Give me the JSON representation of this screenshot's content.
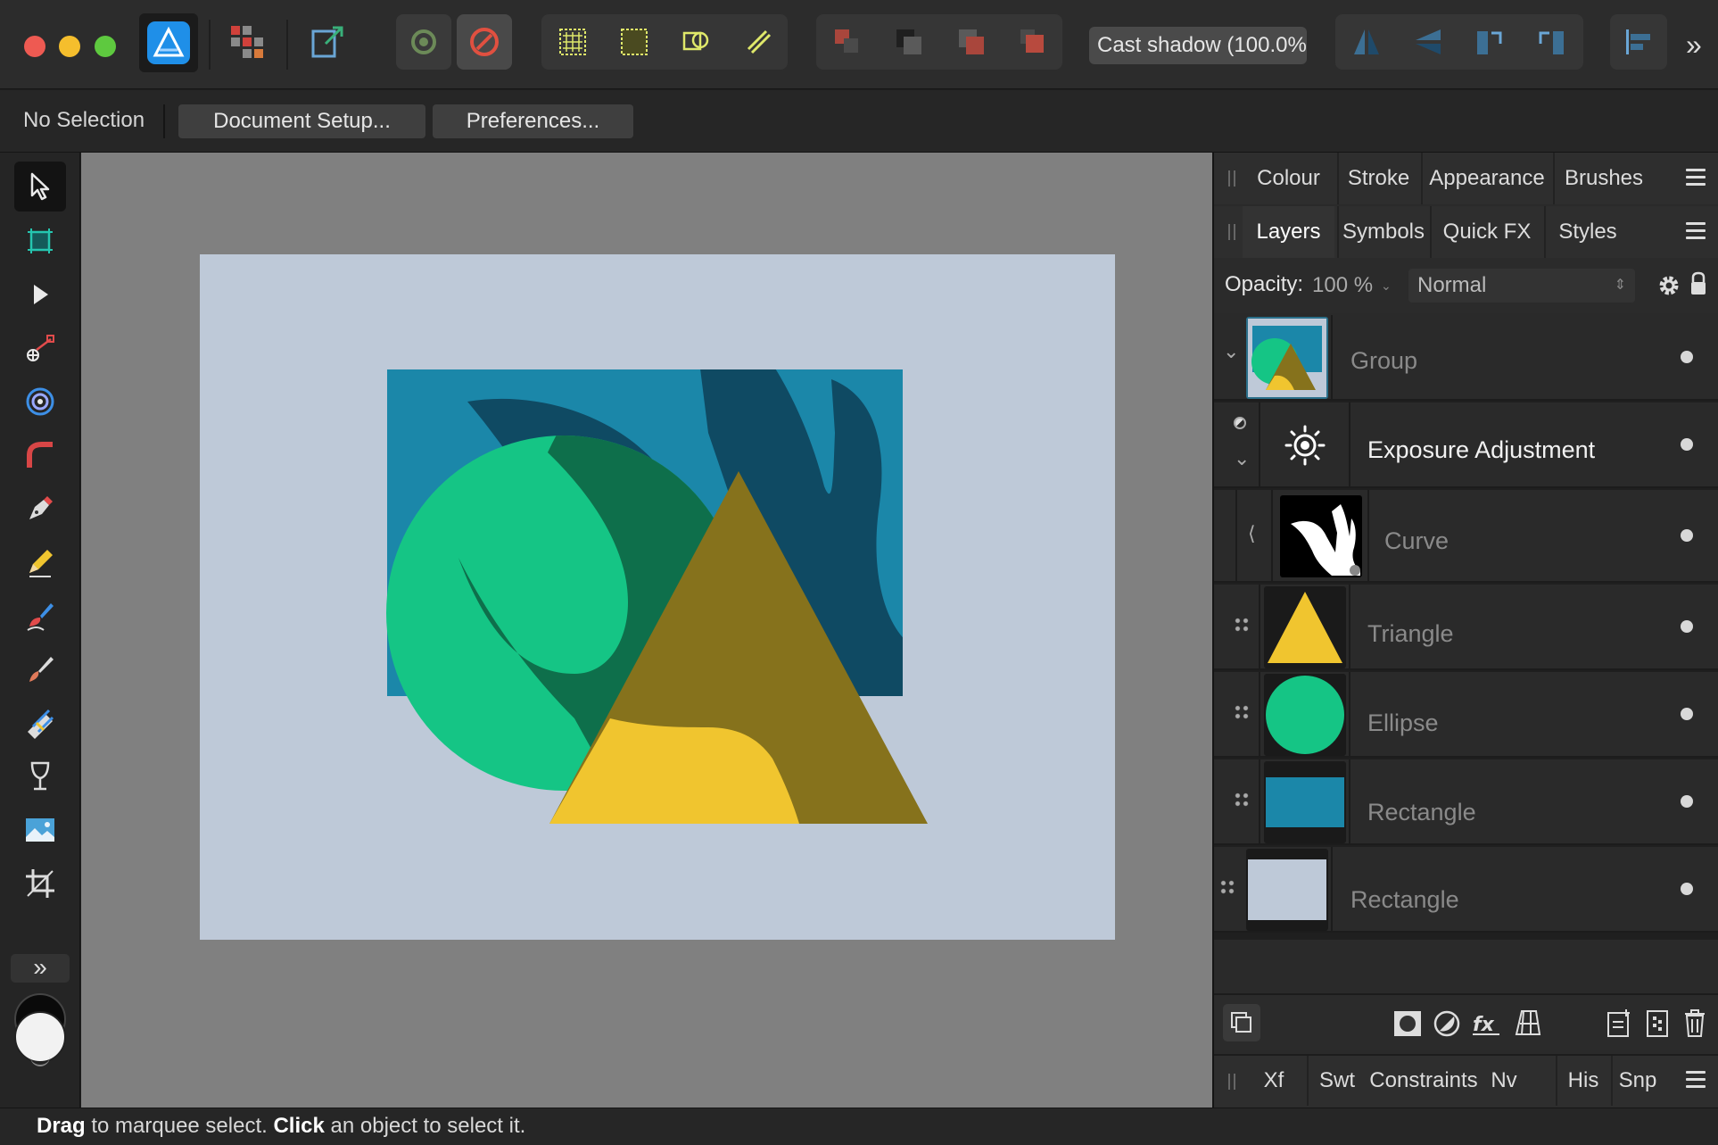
{
  "window": {
    "app_icon": "affinity-designer-logo",
    "traffic_lights": {
      "close_color": "#ee5a52",
      "minimize_color": "#f5be2d",
      "zoom_color": "#5ec93f"
    }
  },
  "toolbar": {
    "style_preset_value": "Cast shadow (100.0%",
    "icons": [
      "persona-designer-icon",
      "persona-pixel-icon",
      "persona-export-icon",
      "snapping-manager-icon",
      "snapping-toggle-icon",
      "grid-icon",
      "pixel-grid-icon",
      "shape-icon",
      "link-icon",
      "move-back-icon",
      "move-backward-icon",
      "move-forward-icon",
      "move-front-icon",
      "flip-horizontal-icon",
      "flip-vertical-icon",
      "rotate-left-icon",
      "rotate-right-icon",
      "align-icon",
      "chevrons-right-icon"
    ]
  },
  "context": {
    "selection_label": "No Selection",
    "document_setup_label": "Document Setup...",
    "preferences_label": "Preferences..."
  },
  "tools": [
    "move-tool",
    "artboard-tool",
    "node-tool",
    "point-transform-tool",
    "contour-tool",
    "corner-tool",
    "pen-tool",
    "pencil-tool",
    "vector-brush-tool",
    "paint-brush-tool",
    "vector-flood-fill-tool",
    "transparency-tool",
    "place-image-tool",
    "vector-crop-tool"
  ],
  "colors": {
    "artboard_bg": "#bec9d8",
    "rect_blue": "#1b87a9",
    "dark_teal": "#0f4a63",
    "ellipse_green": "#15c585",
    "dark_green": "#0e6f4b",
    "triangle_olive": "#86721c",
    "triangle_yellow": "#f0c52f",
    "accent": "#3d8fe6"
  },
  "panels": {
    "top_tabs": [
      "Colour",
      "Stroke",
      "Appearance",
      "Brushes"
    ],
    "layer_tabs": [
      "Layers",
      "Symbols",
      "Quick FX",
      "Styles"
    ],
    "opacity_label": "Opacity:",
    "opacity_value": "100 %",
    "blend_mode": "Normal",
    "layers": [
      {
        "name": "Group",
        "icon": "group-thumbnail"
      },
      {
        "name": "Exposure Adjustment",
        "icon": "exposure-adjustment-icon"
      },
      {
        "name": "Curve",
        "icon": "curve-mask-thumbnail"
      },
      {
        "name": "Triangle",
        "icon": "triangle-thumbnail"
      },
      {
        "name": "Ellipse",
        "icon": "ellipse-thumbnail"
      },
      {
        "name": "Rectangle",
        "icon": "rectangle-blue-thumbnail"
      },
      {
        "name": "Rectangle",
        "icon": "rectangle-light-thumbnail"
      }
    ],
    "bottom_tabs": [
      "Xf",
      "Swt",
      "Constraints",
      "Nv",
      "His",
      "Snp"
    ]
  },
  "status": {
    "drag_word": "Drag",
    "drag_text": " to marquee select. ",
    "click_word": "Click",
    "click_text": " an object to select it."
  }
}
